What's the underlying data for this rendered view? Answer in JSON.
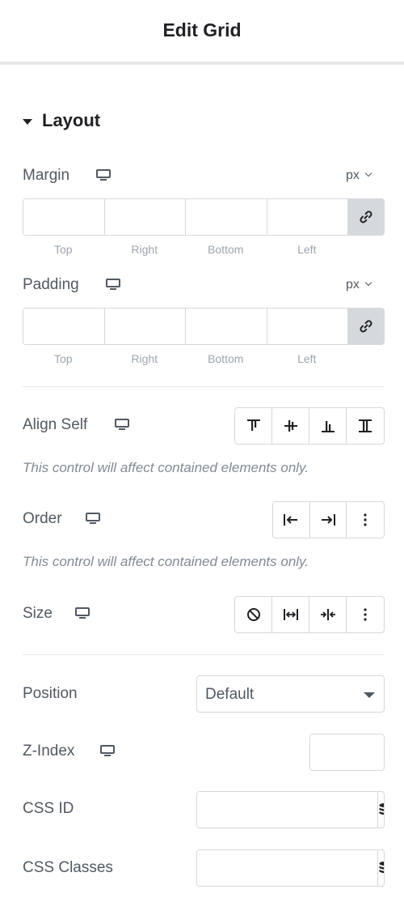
{
  "header": {
    "title": "Edit Grid"
  },
  "section": {
    "label": "Layout",
    "icon": "caret-down-icon"
  },
  "margin": {
    "label": "Margin",
    "unit": "px",
    "values": [
      "",
      "",
      "",
      ""
    ],
    "sides": [
      "Top",
      "Right",
      "Bottom",
      "Left"
    ],
    "link_icon": "link-icon"
  },
  "padding": {
    "label": "Padding",
    "unit": "px",
    "values": [
      "",
      "",
      "",
      ""
    ],
    "sides": [
      "Top",
      "Right",
      "Bottom",
      "Left"
    ],
    "link_icon": "link-icon"
  },
  "align_self": {
    "label": "Align Self",
    "options": [
      "align-start-icon",
      "align-center-icon",
      "align-end-icon",
      "align-stretch-icon"
    ],
    "note": "This control will affect contained elements only."
  },
  "order": {
    "label": "Order",
    "options": [
      "order-start-icon",
      "order-end-icon",
      "more-icon"
    ],
    "note": "This control will affect contained elements only."
  },
  "size": {
    "label": "Size",
    "options": [
      "none-icon",
      "grow-icon",
      "shrink-icon",
      "more-icon"
    ]
  },
  "position": {
    "label": "Position",
    "value": "Default"
  },
  "z_index": {
    "label": "Z-Index",
    "value": ""
  },
  "css_id": {
    "label": "CSS ID",
    "value": "",
    "icon": "dynamic-tags-icon"
  },
  "css_classes": {
    "label": "CSS Classes",
    "value": "",
    "icon": "dynamic-tags-icon"
  },
  "colors": {
    "text": "#1f2124",
    "label": "#515962",
    "border": "#d5d8dc",
    "muted": "#818a96",
    "link_bg": "#d5d8dc"
  }
}
